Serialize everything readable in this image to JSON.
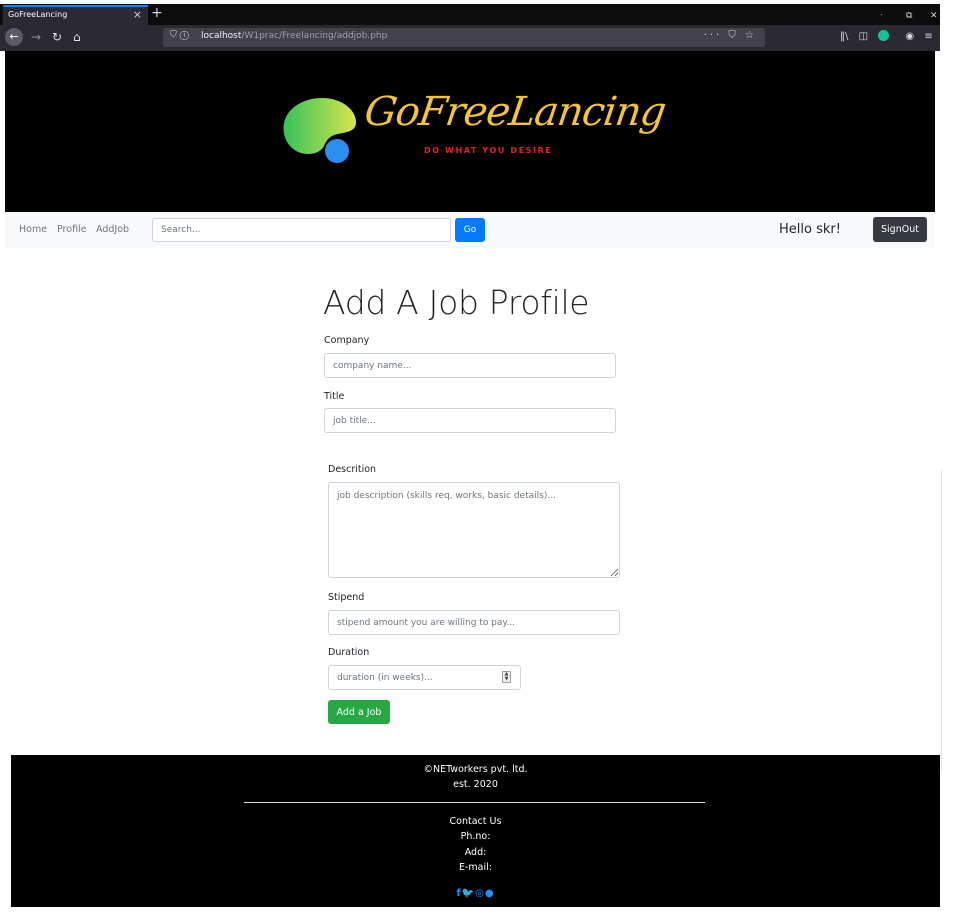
{
  "browser": {
    "tab_title": "GoFreeLancing",
    "tab_close": "×",
    "new_tab": "+",
    "url_host": "localhost",
    "url_path": "/W1prac/Freelancing/addjob.php",
    "window_controls": [
      "ᐧ",
      "⧉",
      "✕"
    ]
  },
  "site": {
    "logo_name": "GoFreeLancing",
    "tagline": "DO WHAT YOU DESIRE",
    "colors": {
      "logo_yellow": "#f5c23c",
      "tagline_red": "#e8202a"
    }
  },
  "navbar": {
    "links": [
      "Home",
      "Profile",
      "AddJob"
    ],
    "search_placeholder": "Search...",
    "go_label": "Go",
    "greeting": "Hello skr!",
    "signout_label": "SignOut"
  },
  "form": {
    "title": "Add A Job Profile",
    "company_label": "Company",
    "company_placeholder": "company name...",
    "title_label": "Title",
    "title_placeholder": "job title...",
    "description_label": "Descrition",
    "description_placeholder": "job description (skills req, works, basic details)...",
    "stipend_label": "Stipend",
    "stipend_placeholder": "stipend amount you are willing to pay...",
    "duration_label": "Duration",
    "duration_placeholder": "duration (in weeks)...",
    "submit_label": "Add a Job"
  },
  "footer": {
    "company": "©NETworkers pvt. ltd.",
    "established": "est. 2020",
    "contact_heading": "Contact Us",
    "phone_label": "Ph.no:",
    "address_label": "Add:",
    "email_label": "E-mail:",
    "social_icons": [
      "facebook-icon",
      "twitter-icon",
      "instagram-icon",
      "github-icon"
    ]
  }
}
